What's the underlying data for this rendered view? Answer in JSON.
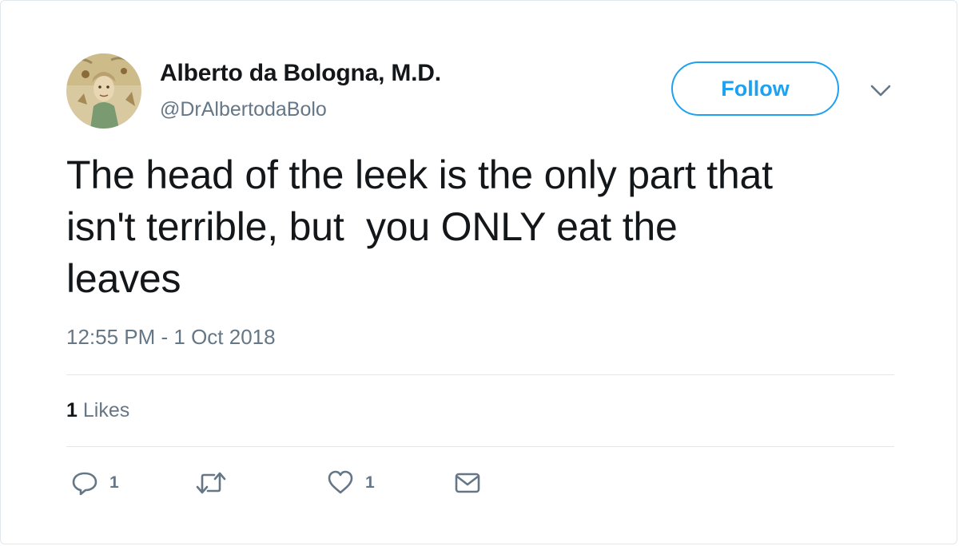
{
  "author": {
    "display_name": "Alberto da Bologna, M.D.",
    "handle": "@DrAlbertodaBolo"
  },
  "follow_button": {
    "label": "Follow"
  },
  "tweet": {
    "text": "The head of the leek is the only part that\nisn't terrible, but  you ONLY eat the\nleaves",
    "timestamp": "12:55 PM - 1 Oct 2018"
  },
  "stats": {
    "likes_count": "1",
    "likes_label": "Likes"
  },
  "actions": {
    "reply_count": "1",
    "like_count": "1"
  },
  "icons": {
    "reply": "reply-icon",
    "retweet": "retweet-icon",
    "like": "heart-icon",
    "direct_message": "envelope-icon",
    "more": "chevron-down-icon"
  },
  "colors": {
    "accent": "#1da1f2",
    "text_primary": "#14171a",
    "text_secondary": "#657786",
    "border": "#e1e8ed"
  }
}
